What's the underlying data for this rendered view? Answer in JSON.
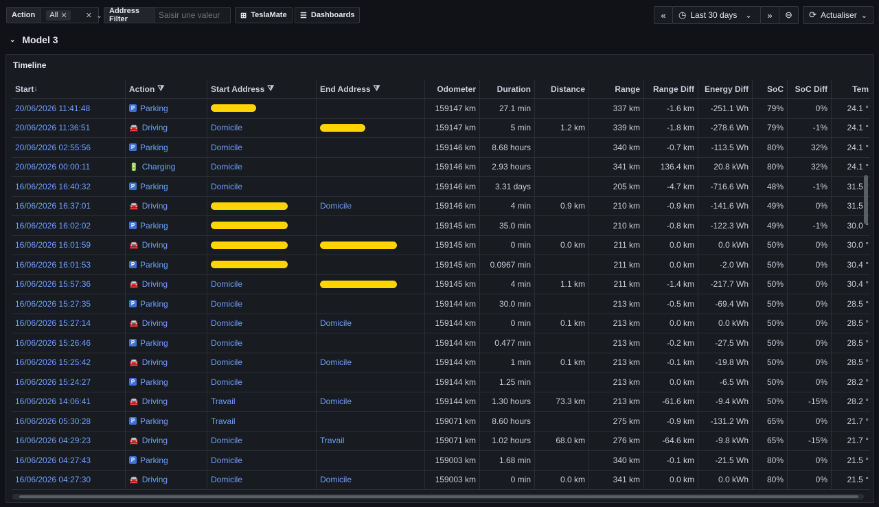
{
  "toolbar": {
    "action_label": "Action",
    "action_value": "All",
    "address_filter_label": "Address Filter",
    "address_placeholder": "Saisir une valeur",
    "teslamate_label": "TeslaMate",
    "dashboards_label": "Dashboards",
    "time_range": "Last 30 days",
    "refresh_label": "Actualiser"
  },
  "section_title": "Model 3",
  "panel_title": "Timeline",
  "columns": [
    "Start",
    "Action",
    "Start Address",
    "End Address",
    "Odometer",
    "Duration",
    "Distance",
    "Range",
    "Range Diff",
    "Energy Diff",
    "SoC",
    "SoC Diff",
    "Tem"
  ],
  "rows": [
    {
      "start": "20/06/2026 11:41:48",
      "action": "Parking",
      "icon": "parking-icon",
      "start_addr": "",
      "start_redacted": true,
      "end_addr": "",
      "end_redacted": false,
      "odometer": "159147 km",
      "duration": "27.1 min",
      "distance": "",
      "range": "337 km",
      "range_diff": "-1.6 km",
      "energy_diff": "-251.1 Wh",
      "soc": "79%",
      "soc_diff": "0%",
      "temp": "24.1 °"
    },
    {
      "start": "20/06/2026 11:36:51",
      "action": "Driving",
      "icon": "car-icon",
      "start_addr": "Domicile",
      "start_redacted": false,
      "end_addr": "",
      "end_redacted": true,
      "odometer": "159147 km",
      "duration": "5 min",
      "distance": "1.2 km",
      "range": "339 km",
      "range_diff": "-1.8 km",
      "energy_diff": "-278.6 Wh",
      "soc": "79%",
      "soc_diff": "-1%",
      "temp": "24.1 °"
    },
    {
      "start": "20/06/2026 02:55:56",
      "action": "Parking",
      "icon": "parking-icon",
      "start_addr": "Domicile",
      "start_redacted": false,
      "end_addr": "",
      "end_redacted": false,
      "odometer": "159146 km",
      "duration": "8.68 hours",
      "distance": "",
      "range": "340 km",
      "range_diff": "-0.7 km",
      "energy_diff": "-113.5 Wh",
      "soc": "80%",
      "soc_diff": "32%",
      "temp": "24.1 °"
    },
    {
      "start": "20/06/2026 00:00:11",
      "action": "Charging",
      "icon": "battery-icon",
      "start_addr": "Domicile",
      "start_redacted": false,
      "end_addr": "",
      "end_redacted": false,
      "odometer": "159146 km",
      "duration": "2.93 hours",
      "distance": "",
      "range": "341 km",
      "range_diff": "136.4 km",
      "energy_diff": "20.8 kWh",
      "soc": "80%",
      "soc_diff": "32%",
      "temp": "24.1 °"
    },
    {
      "start": "16/06/2026 16:40:32",
      "action": "Parking",
      "icon": "parking-icon",
      "start_addr": "Domicile",
      "start_redacted": false,
      "end_addr": "",
      "end_redacted": false,
      "odometer": "159146 km",
      "duration": "3.31 days",
      "distance": "",
      "range": "205 km",
      "range_diff": "-4.7 km",
      "energy_diff": "-716.6 Wh",
      "soc": "48%",
      "soc_diff": "-1%",
      "temp": "31.5 °"
    },
    {
      "start": "16/06/2026 16:37:01",
      "action": "Driving",
      "icon": "car-icon",
      "start_addr": "",
      "start_redacted": true,
      "end_addr": "Domicile",
      "end_redacted": false,
      "odometer": "159146 km",
      "duration": "4 min",
      "distance": "0.9 km",
      "range": "210 km",
      "range_diff": "-0.9 km",
      "energy_diff": "-141.6 Wh",
      "soc": "49%",
      "soc_diff": "0%",
      "temp": "31.5 °"
    },
    {
      "start": "16/06/2026 16:02:02",
      "action": "Parking",
      "icon": "parking-icon",
      "start_addr": "",
      "start_redacted": true,
      "end_addr": "",
      "end_redacted": false,
      "odometer": "159145 km",
      "duration": "35.0 min",
      "distance": "",
      "range": "210 km",
      "range_diff": "-0.8 km",
      "energy_diff": "-122.3 Wh",
      "soc": "49%",
      "soc_diff": "-1%",
      "temp": "30.0 °"
    },
    {
      "start": "16/06/2026 16:01:59",
      "action": "Driving",
      "icon": "car-icon",
      "start_addr": "",
      "start_redacted": true,
      "end_addr": "",
      "end_redacted": true,
      "odometer": "159145 km",
      "duration": "0 min",
      "distance": "0.0 km",
      "range": "211 km",
      "range_diff": "0.0 km",
      "energy_diff": "0.0 kWh",
      "soc": "50%",
      "soc_diff": "0%",
      "temp": "30.0 °"
    },
    {
      "start": "16/06/2026 16:01:53",
      "action": "Parking",
      "icon": "parking-icon",
      "start_addr": "",
      "start_redacted": true,
      "end_addr": "",
      "end_redacted": false,
      "odometer": "159145 km",
      "duration": "0.0967 min",
      "distance": "",
      "range": "211 km",
      "range_diff": "0.0 km",
      "energy_diff": "-2.0 Wh",
      "soc": "50%",
      "soc_diff": "0%",
      "temp": "30.4 °"
    },
    {
      "start": "16/06/2026 15:57:36",
      "action": "Driving",
      "icon": "car-icon",
      "start_addr": "Domicile",
      "start_redacted": false,
      "end_addr": "",
      "end_redacted": true,
      "odometer": "159145 km",
      "duration": "4 min",
      "distance": "1.1 km",
      "range": "211 km",
      "range_diff": "-1.4 km",
      "energy_diff": "-217.7 Wh",
      "soc": "50%",
      "soc_diff": "0%",
      "temp": "30.4 °"
    },
    {
      "start": "16/06/2026 15:27:35",
      "action": "Parking",
      "icon": "parking-icon",
      "start_addr": "Domicile",
      "start_redacted": false,
      "end_addr": "",
      "end_redacted": false,
      "odometer": "159144 km",
      "duration": "30.0 min",
      "distance": "",
      "range": "213 km",
      "range_diff": "-0.5 km",
      "energy_diff": "-69.4 Wh",
      "soc": "50%",
      "soc_diff": "0%",
      "temp": "28.5 °"
    },
    {
      "start": "16/06/2026 15:27:14",
      "action": "Driving",
      "icon": "car-icon",
      "start_addr": "Domicile",
      "start_redacted": false,
      "end_addr": "Domicile",
      "end_redacted": false,
      "odometer": "159144 km",
      "duration": "0 min",
      "distance": "0.1 km",
      "range": "213 km",
      "range_diff": "0.0 km",
      "energy_diff": "0.0 kWh",
      "soc": "50%",
      "soc_diff": "0%",
      "temp": "28.5 °"
    },
    {
      "start": "16/06/2026 15:26:46",
      "action": "Parking",
      "icon": "parking-icon",
      "start_addr": "Domicile",
      "start_redacted": false,
      "end_addr": "",
      "end_redacted": false,
      "odometer": "159144 km",
      "duration": "0.477 min",
      "distance": "",
      "range": "213 km",
      "range_diff": "-0.2 km",
      "energy_diff": "-27.5 Wh",
      "soc": "50%",
      "soc_diff": "0%",
      "temp": "28.5 °"
    },
    {
      "start": "16/06/2026 15:25:42",
      "action": "Driving",
      "icon": "car-icon",
      "start_addr": "Domicile",
      "start_redacted": false,
      "end_addr": "Domicile",
      "end_redacted": false,
      "odometer": "159144 km",
      "duration": "1 min",
      "distance": "0.1 km",
      "range": "213 km",
      "range_diff": "-0.1 km",
      "energy_diff": "-19.8 Wh",
      "soc": "50%",
      "soc_diff": "0%",
      "temp": "28.5 °"
    },
    {
      "start": "16/06/2026 15:24:27",
      "action": "Parking",
      "icon": "parking-icon",
      "start_addr": "Domicile",
      "start_redacted": false,
      "end_addr": "",
      "end_redacted": false,
      "odometer": "159144 km",
      "duration": "1.25 min",
      "distance": "",
      "range": "213 km",
      "range_diff": "0.0 km",
      "energy_diff": "-6.5 Wh",
      "soc": "50%",
      "soc_diff": "0%",
      "temp": "28.2 °"
    },
    {
      "start": "16/06/2026 14:06:41",
      "action": "Driving",
      "icon": "car-icon",
      "start_addr": "Travail",
      "start_redacted": false,
      "end_addr": "Domicile",
      "end_redacted": false,
      "odometer": "159144 km",
      "duration": "1.30 hours",
      "distance": "73.3 km",
      "range": "213 km",
      "range_diff": "-61.6 km",
      "energy_diff": "-9.4 kWh",
      "soc": "50%",
      "soc_diff": "-15%",
      "temp": "28.2 °"
    },
    {
      "start": "16/06/2026 05:30:28",
      "action": "Parking",
      "icon": "parking-icon",
      "start_addr": "Travail",
      "start_redacted": false,
      "end_addr": "",
      "end_redacted": false,
      "odometer": "159071 km",
      "duration": "8.60 hours",
      "distance": "",
      "range": "275 km",
      "range_diff": "-0.9 km",
      "energy_diff": "-131.2 Wh",
      "soc": "65%",
      "soc_diff": "0%",
      "temp": "21.7 °"
    },
    {
      "start": "16/06/2026 04:29:23",
      "action": "Driving",
      "icon": "car-icon",
      "start_addr": "Domicile",
      "start_redacted": false,
      "end_addr": "Travail",
      "end_redacted": false,
      "odometer": "159071 km",
      "duration": "1.02 hours",
      "distance": "68.0 km",
      "range": "276 km",
      "range_diff": "-64.6 km",
      "energy_diff": "-9.8 kWh",
      "soc": "65%",
      "soc_diff": "-15%",
      "temp": "21.7 °"
    },
    {
      "start": "16/06/2026 04:27:43",
      "action": "Parking",
      "icon": "parking-icon",
      "start_addr": "Domicile",
      "start_redacted": false,
      "end_addr": "",
      "end_redacted": false,
      "odometer": "159003 km",
      "duration": "1.68 min",
      "distance": "",
      "range": "340 km",
      "range_diff": "-0.1 km",
      "energy_diff": "-21.5 Wh",
      "soc": "80%",
      "soc_diff": "0%",
      "temp": "21.5 °"
    },
    {
      "start": "16/06/2026 04:27:30",
      "action": "Driving",
      "icon": "car-icon",
      "start_addr": "Domicile",
      "start_redacted": false,
      "end_addr": "Domicile",
      "end_redacted": false,
      "odometer": "159003 km",
      "duration": "0 min",
      "distance": "0.0 km",
      "range": "341 km",
      "range_diff": "0.0 km",
      "energy_diff": "0.0 kWh",
      "soc": "80%",
      "soc_diff": "0%",
      "temp": "21.5 °"
    }
  ]
}
